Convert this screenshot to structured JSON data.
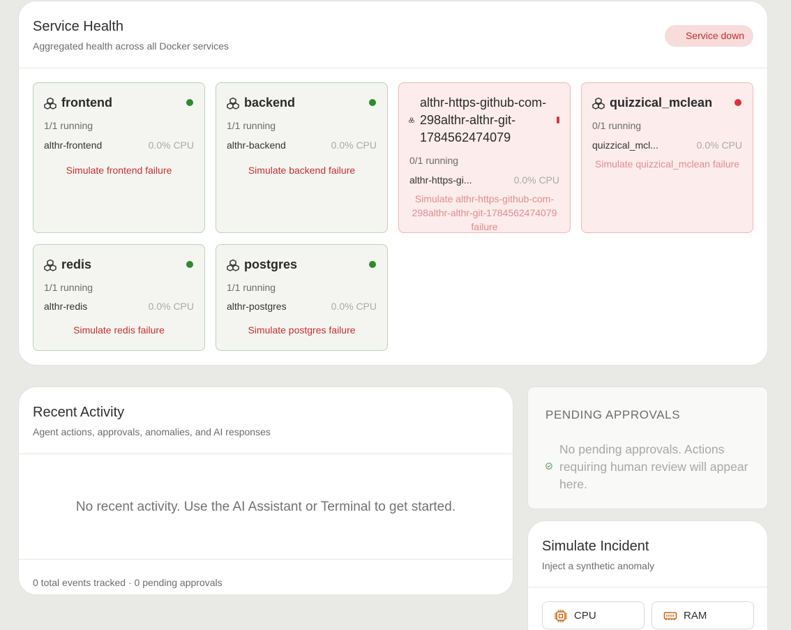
{
  "service_health": {
    "title": "Service Health",
    "subtitle": "Aggregated health across all Docker services",
    "status": "Service down",
    "services": [
      {
        "name": "frontend",
        "running": "1/1 running",
        "container": "althr-frontend",
        "cpu": "0.0% CPU",
        "action": "Simulate frontend failure",
        "state": "up"
      },
      {
        "name": "backend",
        "running": "1/1 running",
        "container": "althr-backend",
        "cpu": "0.0% CPU",
        "action": "Simulate backend failure",
        "state": "up"
      },
      {
        "name": "althr-https-github-com-298althr-althr-git-1784562474079",
        "running": "0/1 running",
        "container": "althr-https-gi...",
        "cpu": "0.0% CPU",
        "action": "Simulate althr-https-github-com-298althr-althr-git-1784562474079 failure",
        "state": "down"
      },
      {
        "name": "quizzical_mclean",
        "running": "0/1 running",
        "container": "quizzical_mcl...",
        "cpu": "0.0% CPU",
        "action": "Simulate quizzical_mclean failure",
        "state": "down"
      },
      {
        "name": "redis",
        "running": "1/1 running",
        "container": "althr-redis",
        "cpu": "0.0% CPU",
        "action": "Simulate redis failure",
        "state": "up"
      },
      {
        "name": "postgres",
        "running": "1/1 running",
        "container": "althr-postgres",
        "cpu": "0.0% CPU",
        "action": "Simulate postgres failure",
        "state": "up"
      }
    ]
  },
  "recent_activity": {
    "title": "Recent Activity",
    "subtitle": "Agent actions, approvals, anomalies, and AI responses",
    "empty": "No recent activity. Use the AI Assistant or Terminal to get started.",
    "footer": "0 total events tracked · 0 pending approvals"
  },
  "pending_approvals": {
    "title": "PENDING APPROVALS",
    "empty": "No pending approvals. Actions requiring human review will appear here."
  },
  "simulate_incident": {
    "title": "Simulate Incident",
    "subtitle": "Inject a synthetic anomaly",
    "buttons": [
      {
        "label": "CPU",
        "icon": "cpu-chip-icon"
      },
      {
        "label": "RAM",
        "icon": "memory-stick-icon"
      }
    ]
  },
  "colors": {
    "ok": "#2e8b2e",
    "down": "#d9343a",
    "accent_text": "#c62f2f",
    "icon_orange": "#c96a12"
  }
}
